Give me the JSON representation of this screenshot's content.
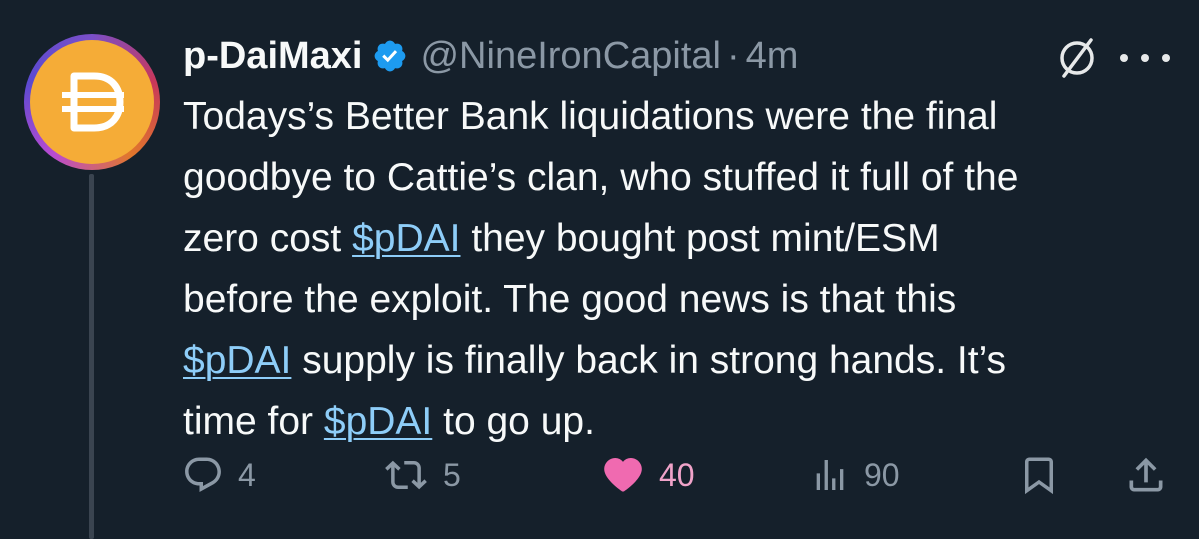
{
  "tweet": {
    "author_name": "p-DaiMaxi",
    "handle": "@NineIronCapital",
    "separator": "·",
    "time": "4m",
    "body": {
      "line1": "Todays’s Better Bank liquidations were the final",
      "line2": "goodbye to Cattie’s clan, who stuffed it full of the",
      "line3_pre": "zero cost ",
      "line3_tag": "$pDAI",
      "line3_post": " they bought post mint/ESM",
      "line4": "before the exploit. The good news is that this",
      "line5_tag": "$pDAI",
      "line5_post": " supply is finally back in strong hands. It’s",
      "line6_pre": "time for ",
      "line6_tag": "$pDAI",
      "line6_post": " to go up."
    },
    "actions": {
      "replies": "4",
      "reposts": "5",
      "likes": "40",
      "views": "90"
    }
  },
  "icons": {
    "verified": "verified-badge-icon",
    "grok": "grok-icon",
    "more": "more-icon",
    "reply": "reply-icon",
    "repost": "repost-icon",
    "like": "heart-icon",
    "views": "views-icon",
    "bookmark": "bookmark-icon",
    "share": "share-icon"
  },
  "colors": {
    "background": "#15202b",
    "text": "#f7f9f9",
    "secondary": "#8b98a5",
    "link": "#8ecdf8",
    "verified": "#1d9bf0",
    "like": "#f91880",
    "avatar_bg": "#f5ac37"
  }
}
